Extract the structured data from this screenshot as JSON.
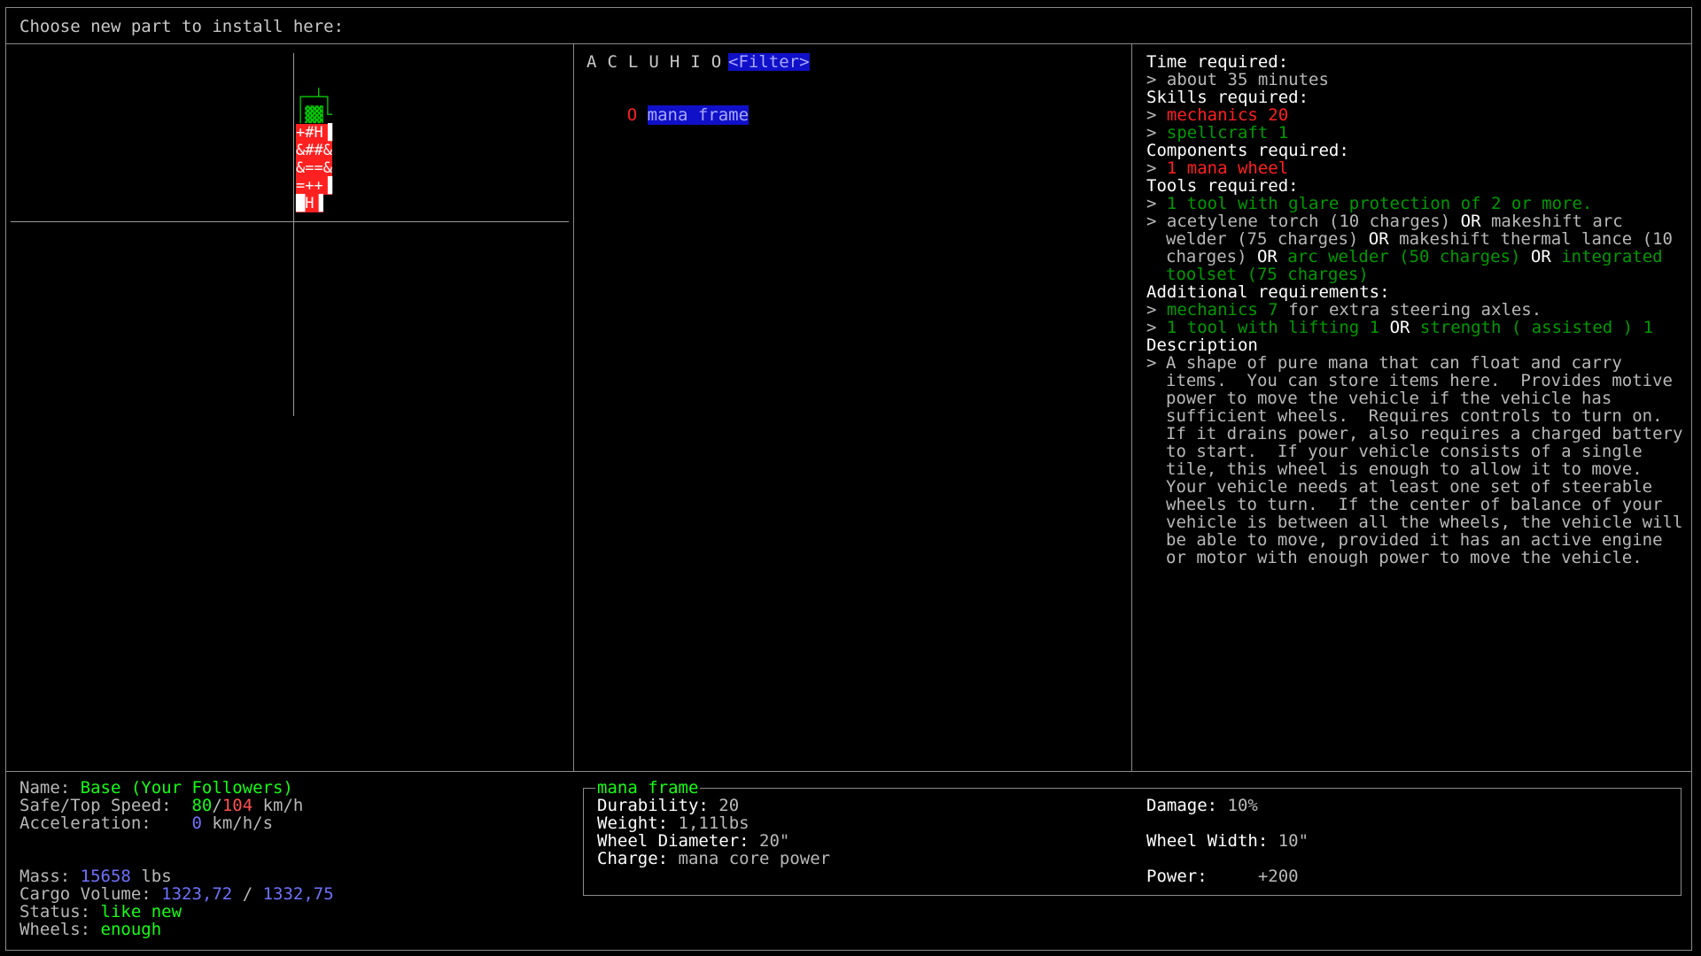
{
  "header": {
    "prompt": "Choose new part to install here:"
  },
  "list_panel": {
    "tabs": [
      "A",
      "C",
      "L",
      "U",
      "H",
      "I",
      "O"
    ],
    "filter_label": "<Filter>",
    "items": [
      {
        "hotkey": "O",
        "name": "mana frame",
        "selected": true
      }
    ]
  },
  "requirements": {
    "time_heading": "Time required:",
    "time_value": "about 35 minutes",
    "skills_heading": "Skills required:",
    "skills": [
      {
        "text": "mechanics 20",
        "color": "#ff2020"
      },
      {
        "text": "spellcraft 1",
        "color": "#009a00"
      }
    ],
    "components_heading": "Components required:",
    "components": [
      {
        "text": "1 mana wheel",
        "color": "#ff2020"
      }
    ],
    "tools_heading": "Tools required:",
    "tool_glare": "1 tool with glare protection of 2 or more.",
    "tool_opt1": "acetylene torch (10 charges)",
    "or": "OR",
    "tool_opt2a": "makeshift arc",
    "tool_opt2b": "welder (75 charges)",
    "tool_opt3a": "makeshift thermal lance (10",
    "tool_opt3b": "charges)",
    "tool_opt4": "arc welder (50 charges)",
    "tool_opt5a": "integrated",
    "tool_opt5b": "toolset (75 charges)",
    "additional_heading": "Additional requirements:",
    "add1_skill": "mechanics 7",
    "add1_rest": "for extra steering axles.",
    "add2_a": "1 tool with lifting 1",
    "add2_b": "strength ( assisted ) 1",
    "description_heading": "Description",
    "description_lines": [
      "A shape of pure mana that can float and carry",
      "items.  You can store items here.  Provides motive",
      "power to move the vehicle if the vehicle has",
      "sufficient wheels.  Requires controls to turn on.",
      "If it drains power, also requires a charged battery",
      "to start.  If your vehicle consists of a single",
      "tile, this wheel is enough to allow it to move.",
      "Your vehicle needs at least one set of steerable",
      "wheels to turn.  If the center of balance of your",
      "vehicle is between all the wheels, the vehicle will",
      "be able to move, provided it has an active engine",
      "or motor with enough power to move the vehicle."
    ]
  },
  "vehicle_info": {
    "name_label": "Name:",
    "name_value": "Base (Your Followers)",
    "speed_label": "Safe/Top Speed:",
    "safe_speed": "80",
    "slash": "/",
    "top_speed": "104",
    "speed_unit": "km/h",
    "accel_label": "Acceleration:",
    "accel_value": "0",
    "accel_unit": "km/h/s",
    "mass_label": "Mass:",
    "mass_value": "15658",
    "mass_unit": "lbs",
    "cargo_label": "Cargo Volume:",
    "cargo_used": "1323,72",
    "cargo_sep": "/",
    "cargo_total": "1332,75",
    "status_label": "Status:",
    "status_value": "like new",
    "wheels_label": "Wheels:",
    "wheels_value": "enough"
  },
  "part_info": {
    "title": "mana frame",
    "durability_label": "Durability:",
    "durability_value": "20",
    "weight_label": "Weight:",
    "weight_value": "1,11lbs",
    "diameter_label": "Wheel Diameter:",
    "diameter_value": "20\"",
    "charge_label": "Charge:",
    "charge_value": "mana core power",
    "damage_label": "Damage:",
    "damage_value": "10%",
    "width_label": "Wheel Width:",
    "width_value": "10\"",
    "power_label": "Power:",
    "power_value": "+200"
  },
  "map_glyphs": [
    {
      "text": "┌─┴┐",
      "color": "#00c800"
    },
    {
      "text": "│▓▓└",
      "color": "#00c800"
    },
    {
      "text": "+#H▐",
      "color": "#ff2020"
    },
    {
      "text": "&##&",
      "color": "#ff2020"
    },
    {
      "text": "&==&",
      "color": "#ff2020"
    },
    {
      "text": "=++▐",
      "color": "#ff2020"
    },
    {
      "text": "█H▐",
      "color": "#ff2020"
    }
  ],
  "colors": {
    "background": "#000000",
    "border": "#8a8a8a",
    "selection_bg": "#1010c8",
    "good": "#00c800",
    "bad": "#ff2020",
    "value_blue": "#6f72ff"
  }
}
